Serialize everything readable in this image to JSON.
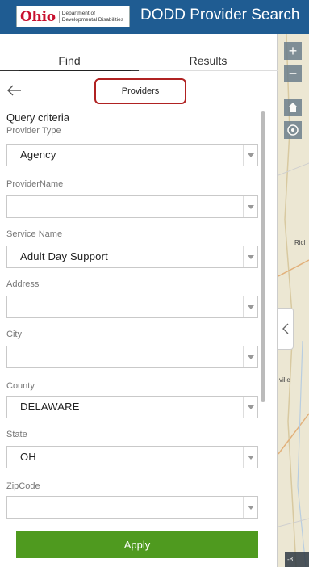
{
  "header": {
    "logo_ohio": "Ohio",
    "logo_dept_line1": "Department of",
    "logo_dept_line2": "Developmental Disabilities",
    "title": "DODD Provider Search"
  },
  "tabs": [
    {
      "label": "Find"
    },
    {
      "label": "Results"
    }
  ],
  "mode_label": "Providers",
  "query_criteria_label": "Query criteria",
  "fields": [
    {
      "label": "Provider Type",
      "value": "Agency"
    },
    {
      "label": "ProviderName",
      "value": ""
    },
    {
      "label": "Service Name",
      "value": "Adult Day Support"
    },
    {
      "label": "Address",
      "value": ""
    },
    {
      "label": "City",
      "value": ""
    },
    {
      "label": "County",
      "value": "DELAWARE"
    },
    {
      "label": "State",
      "value": "OH"
    },
    {
      "label": "ZipCode",
      "value": ""
    }
  ],
  "apply_label": "Apply",
  "map": {
    "labels": [
      "Ricl",
      "ville"
    ],
    "scale_text": "-8"
  },
  "colors": {
    "header_bg": "#1f5c92",
    "apply_bg": "#4f9a1f",
    "highlight_border": "#b02222"
  }
}
